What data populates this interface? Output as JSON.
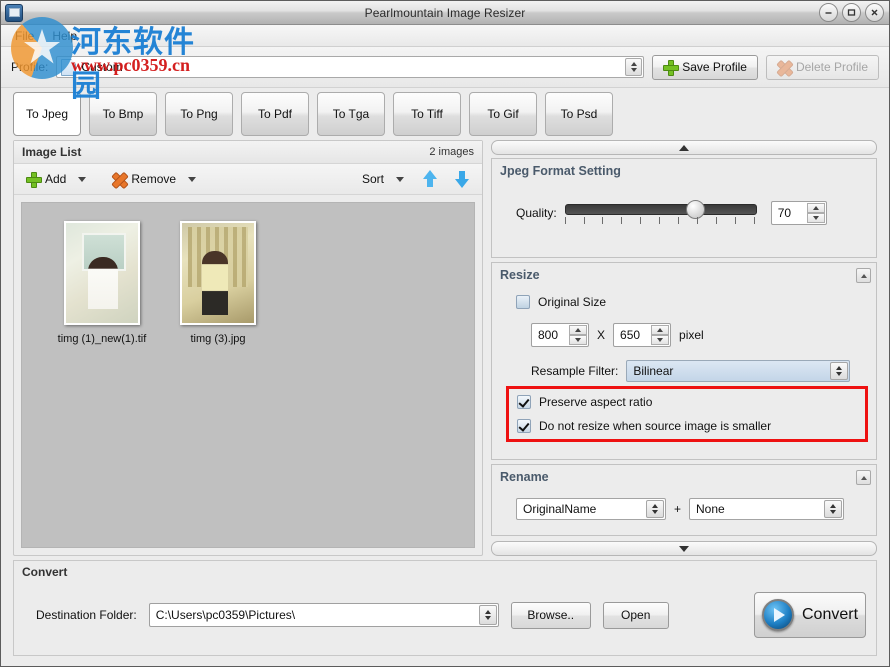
{
  "window": {
    "title": "Pearlmountain Image Resizer",
    "app_icon": "image-app-icon",
    "controls": {
      "minimize": "minimize-icon",
      "maximize": "maximize-icon",
      "close": "close-icon"
    }
  },
  "menu": {
    "items": [
      {
        "label": "File"
      },
      {
        "label": "Help"
      }
    ]
  },
  "watermark": {
    "chinese": "河东软件园",
    "url": "www.pc0359.cn"
  },
  "profile": {
    "label": "Profile:",
    "value": "Custom",
    "save_label": "Save Profile",
    "delete_label": "Delete Profile",
    "delete_disabled": true
  },
  "format_tabs": {
    "active": "To Jpeg",
    "items": [
      {
        "label": "To Jpeg"
      },
      {
        "label": "To Bmp"
      },
      {
        "label": "To Png"
      },
      {
        "label": "To Pdf"
      },
      {
        "label": "To Tga"
      },
      {
        "label": "To Tiff"
      },
      {
        "label": "To Gif"
      },
      {
        "label": "To Psd"
      }
    ]
  },
  "image_list": {
    "title": "Image List",
    "count_text": "2 images",
    "toolbar": {
      "add": "Add",
      "remove": "Remove",
      "sort": "Sort"
    },
    "items": [
      {
        "name": "timg (1)_new(1).tif"
      },
      {
        "name": "timg (3).jpg"
      }
    ]
  },
  "jpeg_setting": {
    "title": "Jpeg Format Setting",
    "quality_label": "Quality:",
    "quality_value": "70",
    "quality_percent": 70
  },
  "resize": {
    "title": "Resize",
    "original_size_label": "Original Size",
    "original_size_checked": false,
    "width": "800",
    "separator": "X",
    "height": "650",
    "unit": "pixel",
    "resample_label": "Resample Filter:",
    "resample_value": "Bilinear",
    "preserve_aspect_label": "Preserve aspect ratio",
    "preserve_aspect_checked": true,
    "no_upscale_label": "Do not resize when source image is smaller",
    "no_upscale_checked": true,
    "highlight_color": "#ee1111"
  },
  "rename": {
    "title": "Rename",
    "first_value": "OriginalName",
    "plus": "+",
    "second_value": "None"
  },
  "convert": {
    "title": "Convert",
    "dest_label": "Destination Folder:",
    "dest_value": "C:\\Users\\pc0359\\Pictures\\",
    "browse_label": "Browse..",
    "open_label": "Open",
    "convert_label": "Convert"
  }
}
